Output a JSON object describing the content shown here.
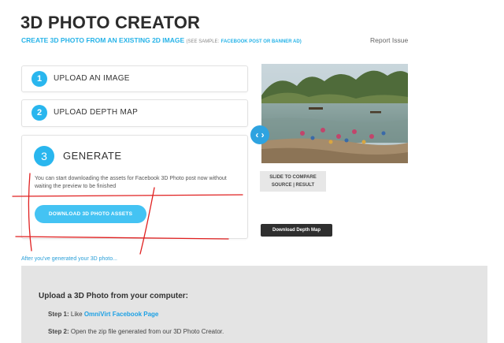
{
  "header": {
    "title": "3D PHOTO CREATOR",
    "subtitle_main": "CREATE 3D PHOTO FROM AN EXISTING 2D IMAGE",
    "subtitle_small": "(SEE SAMPLE:",
    "subtitle_link": "FACEBOOK POST OR BANNER AD)",
    "report_issue": "Report Issue"
  },
  "steps": [
    {
      "number": "1",
      "label": "UPLOAD AN IMAGE"
    },
    {
      "number": "2",
      "label": "UPLOAD DEPTH MAP"
    },
    {
      "number": "3",
      "label": "GENERATE"
    }
  ],
  "generate": {
    "description": "You can start downloading the assets for Facebook 3D Photo post now without waiting the preview to be finished",
    "button": "DOWNLOAD 3D PHOTO ASSETS"
  },
  "preview": {
    "slider_icon": "‹ ›",
    "compare_line1": "SLIDE TO COMPARE",
    "compare_line2": "SOURCE | RESULT",
    "depth_button": "Download Depth Map"
  },
  "after_link": "After you've generated your 3D photo...",
  "upload_section": {
    "title": "Upload a 3D Photo from your computer:",
    "step1_prefix": "Step 1:",
    "step1_text": "Like",
    "step1_link": "OmniVirt Facebook Page",
    "step2_prefix": "Step 2:",
    "step2_text": "Open the zip file generated from our 3D Photo Creator."
  },
  "colors": {
    "accent": "#29b6ee",
    "annotation": "#e02020",
    "dark_button": "#2f2f2f",
    "panel_gray": "#e4e4e4"
  }
}
